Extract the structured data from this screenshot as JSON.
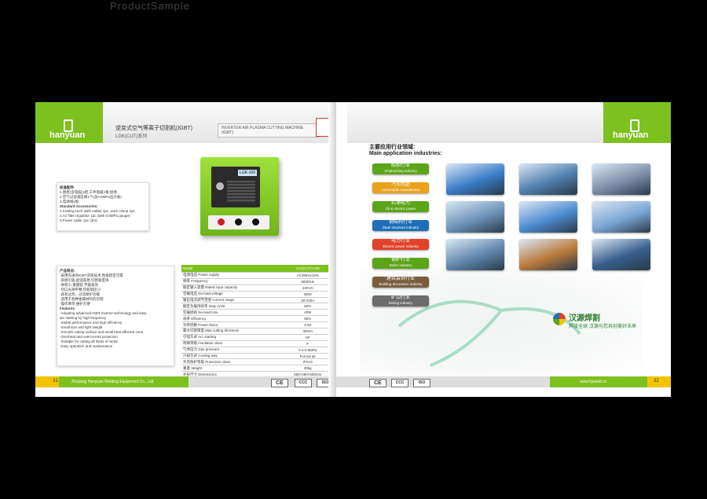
{
  "top_caption": "ProductSample",
  "left_page": {
    "logo": "hanyuan",
    "header_title_cn": "逆变式空气等离子切割机(IGBT)",
    "header_model": "LGK(CUT)系列",
    "header_box_text": "INVERTER AIR PLASMA CUTTING MACHINE (IGBT)",
    "machine_display": "LGK-100",
    "accessories": {
      "title_cn": "标准配件:",
      "lines": [
        "1.割炬(含电缆)1把,工件电缆1根,接地",
        "2.空气过滤减压阀1个(含0.6MPa压力表)",
        "3.电源线1根"
      ],
      "title_en": "Standard Accessories:",
      "lines_en": [
        "1.Cutting torch (with cable) 1pc, work clamp 1pc",
        "2.Air filter regulator 1pc (with 0.6MPa gauge)",
        "3.Power cable 1pc (3m)"
      ]
    },
    "features": {
      "title_cn": "产品特点:",
      "lines_cn": [
        "·采用先进的IGBT逆变技术,性能稳定可靠",
        "·高频引弧,起弧容易,切割速度快",
        "·体积小,重量轻,节能高效",
        "·切口光滑平整,热影响区小",
        "·具有过热、过流保护功能",
        "·适用于各种金属材料的切割",
        "·操作简单,维护方便"
      ],
      "title_en": "Features:",
      "lines_en": [
        "·Adopting advanced IGBT inverter technology and easy",
        "  arc starting by high frequency",
        "·Stable performance and high efficiency",
        "·Small size and light weight",
        "·Smooth cutting surface and small heat affected zone",
        "·Overheat and overcurrent protection",
        "·Suitable for cutting all kinds of metal",
        "·Easy operation and maintenance"
      ]
    },
    "spec_table": {
      "header": [
        "Model",
        "LGK(CUT)-100"
      ],
      "rows": [
        [
          "电源电压 Power supply",
          "AC380V±10%"
        ],
        [
          "频率 Frequency",
          "50/60Hz"
        ],
        [
          "额定输入容量 Rated input capacity",
          "12KVA"
        ],
        [
          "空载电压 No-load voltage",
          "300V"
        ],
        [
          "输出电流调节范围 Current range",
          "20-100A"
        ],
        [
          "额定负载持续率 Duty cycle",
          "60%"
        ],
        [
          "空载损耗 No-load loss",
          "40W"
        ],
        [
          "效率 Efficiency",
          "85%"
        ],
        [
          "功率因数 Power factor",
          "0.93"
        ],
        [
          "最大切割厚度 Max cutting thickness",
          "30mm"
        ],
        [
          "引弧方式 Arc starting",
          "HF"
        ],
        [
          "绝缘等级 Insulation class",
          "F"
        ],
        [
          "气体压力 Gas pressure",
          "0.4-0.6MPa"
        ],
        [
          "冷却方式 Cooling way",
          "Forced air"
        ],
        [
          "外壳防护等级 Protection class",
          "IP21S"
        ],
        [
          "重量 Weight",
          "30kg"
        ],
        [
          "外形尺寸 Dimensions",
          "560×290×530mm"
        ]
      ]
    },
    "footer": {
      "page_no": "31",
      "company": "Zhejiang Hanyuan Welding Equipment Co., Ltd.",
      "certs": [
        "CE",
        "CCC",
        "ISO"
      ]
    }
  },
  "right_page": {
    "logo": "hanyuan",
    "heading_cn": "主要应用行业领域:",
    "heading_en": "Main application industries:",
    "industries": [
      {
        "cn": "船舶行业",
        "en": "Shipbuilding industry",
        "color": "#5aa518"
      },
      {
        "cn": "汽车制造",
        "en": "Automobile manufacture",
        "color": "#e8a21c"
      },
      {
        "cn": "石油电力",
        "en": "Oil & electric power",
        "color": "#5aa518"
      },
      {
        "cn": "钢结构行业",
        "en": "Steel structure industry",
        "color": "#1f6fb8"
      },
      {
        "cn": "电力行业",
        "en": "Electric power industry",
        "color": "#e0422a"
      },
      {
        "cn": "锅炉行业",
        "en": "Boiler industry",
        "color": "#5aa518"
      },
      {
        "cn": "建筑装饰行业",
        "en": "Building decoration industry",
        "color": "#7a5d3e"
      },
      {
        "cn": "矿山行业",
        "en": "Mining industry",
        "color": "#6b6b6b"
      }
    ],
    "photos": [
      {
        "name": "ship",
        "color": "#3a7cc7"
      },
      {
        "name": "steel-structure",
        "color": "#4f7fae"
      },
      {
        "name": "train",
        "color": "#7c8fa8"
      },
      {
        "name": "oil-tanks",
        "color": "#6b93b8"
      },
      {
        "name": "steel-beams",
        "color": "#4d8bd0"
      },
      {
        "name": "airplane",
        "color": "#7aa6d4"
      },
      {
        "name": "building",
        "color": "#5f86ad"
      },
      {
        "name": "mining-trucks",
        "color": "#b97a3a"
      },
      {
        "name": "oil-platform",
        "color": "#375e8c"
      }
    ],
    "brand_cn": "汉源焊割",
    "brand_slogan": "焊接全球·汉源与您共创美好未来",
    "footer": {
      "page_no": "32",
      "website": "www.hyweld.cn",
      "certs": [
        "CE",
        "CCC",
        "ISO"
      ]
    }
  }
}
